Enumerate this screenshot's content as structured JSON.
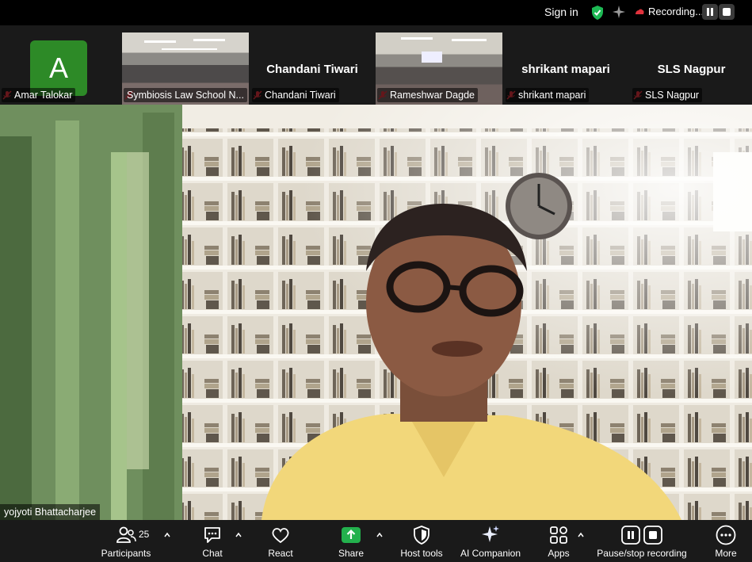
{
  "topbar": {
    "sign_in": "Sign in",
    "recording_status": "Recording...",
    "icons": [
      "shield-check-icon",
      "sparkle-icon",
      "record-icon",
      "pause-icon",
      "stop-icon"
    ]
  },
  "participants_strip": [
    {
      "name": "Amar Talokar",
      "type": "avatar",
      "initial": "A"
    },
    {
      "name": "Symbiosis Law School N...",
      "type": "video"
    },
    {
      "name": "Chandani Tiwari",
      "type": "name_only"
    },
    {
      "name": "Rameshwar Dagde",
      "type": "video"
    },
    {
      "name": "shrikant mapari",
      "type": "name_only"
    },
    {
      "name": "SLS Nagpur",
      "type": "name_only"
    }
  ],
  "main_video": {
    "speaker_name": "yojyoti Bhattacharjee"
  },
  "toolbar": {
    "participants_label": "Participants",
    "participants_count": "25",
    "chat_label": "Chat",
    "react_label": "React",
    "share_label": "Share",
    "host_tools_label": "Host tools",
    "ai_companion_label": "AI Companion",
    "apps_label": "Apps",
    "pause_stop_label": "Pause/stop recording",
    "more_label": "More"
  },
  "colors": {
    "share_green": "#23b14d",
    "avatar_green": "#2d8a27",
    "shield_green": "#1db954",
    "mic_muted_red": "#e0323c"
  }
}
